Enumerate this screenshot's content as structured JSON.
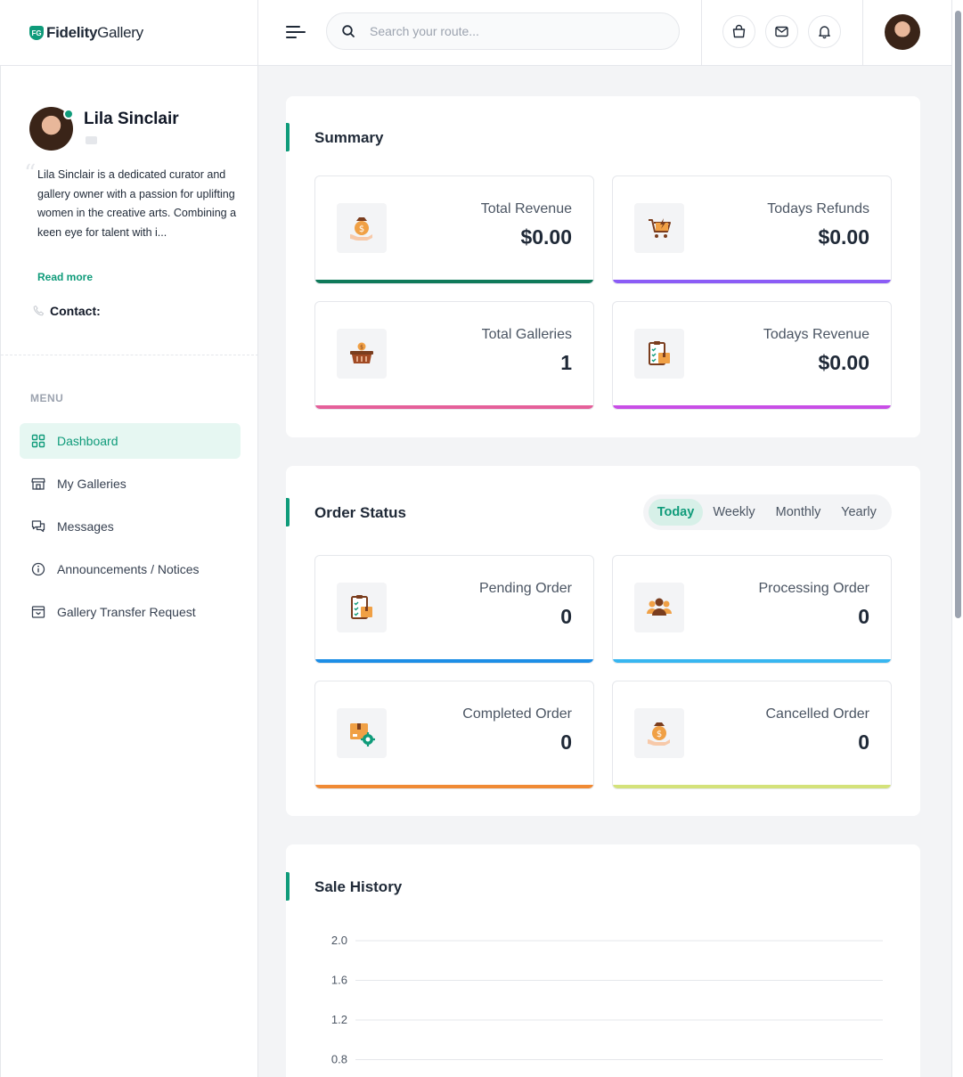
{
  "header": {
    "brand_bold": "Fidelity",
    "brand_light": "Gallery",
    "brand_logo": "FG",
    "search_placeholder": "Search your route...",
    "icons": [
      "menu-icon",
      "search-icon",
      "shopping-bag-icon",
      "mail-icon",
      "bell-icon"
    ]
  },
  "profile": {
    "name": "Lila Sinclair",
    "bio": "Lila Sinclair is a dedicated curator and gallery owner with a passion for uplifting women in the creative arts. Combining a keen eye for talent with i...",
    "read_more": "Read more",
    "contact_label": "Contact:"
  },
  "menu": {
    "heading": "MENU",
    "items": [
      {
        "label": "Dashboard",
        "icon": "grid-icon",
        "active": true
      },
      {
        "label": "My Galleries",
        "icon": "store-icon",
        "active": false
      },
      {
        "label": "Messages",
        "icon": "chat-icon",
        "active": false
      },
      {
        "label": "Announcements / Notices",
        "icon": "info-icon",
        "active": false
      },
      {
        "label": "Gallery Transfer Request",
        "icon": "archive-icon",
        "active": false
      }
    ]
  },
  "summary": {
    "title": "Summary",
    "cards": [
      {
        "label": "Total Revenue",
        "value": "$0.00",
        "color": "#0f7a5a",
        "icon": "money-bag-hand-icon"
      },
      {
        "label": "Todays Refunds",
        "value": "$0.00",
        "color": "#8b5cf6",
        "icon": "cart-refund-icon"
      },
      {
        "label": "Total Galleries",
        "value": "1",
        "color": "#e5609a",
        "icon": "basket-icon"
      },
      {
        "label": "Todays Revenue",
        "value": "$0.00",
        "color": "#c84ee6",
        "icon": "clipboard-box-icon"
      }
    ]
  },
  "order_status": {
    "title": "Order Status",
    "tabs": [
      {
        "label": "Today",
        "active": true
      },
      {
        "label": "Weekly",
        "active": false
      },
      {
        "label": "Monthly",
        "active": false
      },
      {
        "label": "Yearly",
        "active": false
      }
    ],
    "cards": [
      {
        "label": "Pending Order",
        "value": "0",
        "color": "#1d8ee6",
        "icon": "clipboard-box-icon"
      },
      {
        "label": "Processing Order",
        "value": "0",
        "color": "#38b6f0",
        "icon": "people-group-icon"
      },
      {
        "label": "Completed Order",
        "value": "0",
        "color": "#f08a34",
        "icon": "box-gear-icon"
      },
      {
        "label": "Cancelled Order",
        "value": "0",
        "color": "#d4e27a",
        "icon": "money-bag-hand-icon"
      }
    ]
  },
  "sale_history": {
    "title": "Sale History"
  },
  "chart_data": {
    "type": "line",
    "title": "",
    "xlabel": "",
    "ylabel": "",
    "y_ticks": [
      "2.0",
      "1.6",
      "1.2",
      "0.8"
    ],
    "ylim": [
      0,
      2.0
    ],
    "grid": true,
    "series": []
  },
  "colors": {
    "accent": "#0f9b7a"
  }
}
